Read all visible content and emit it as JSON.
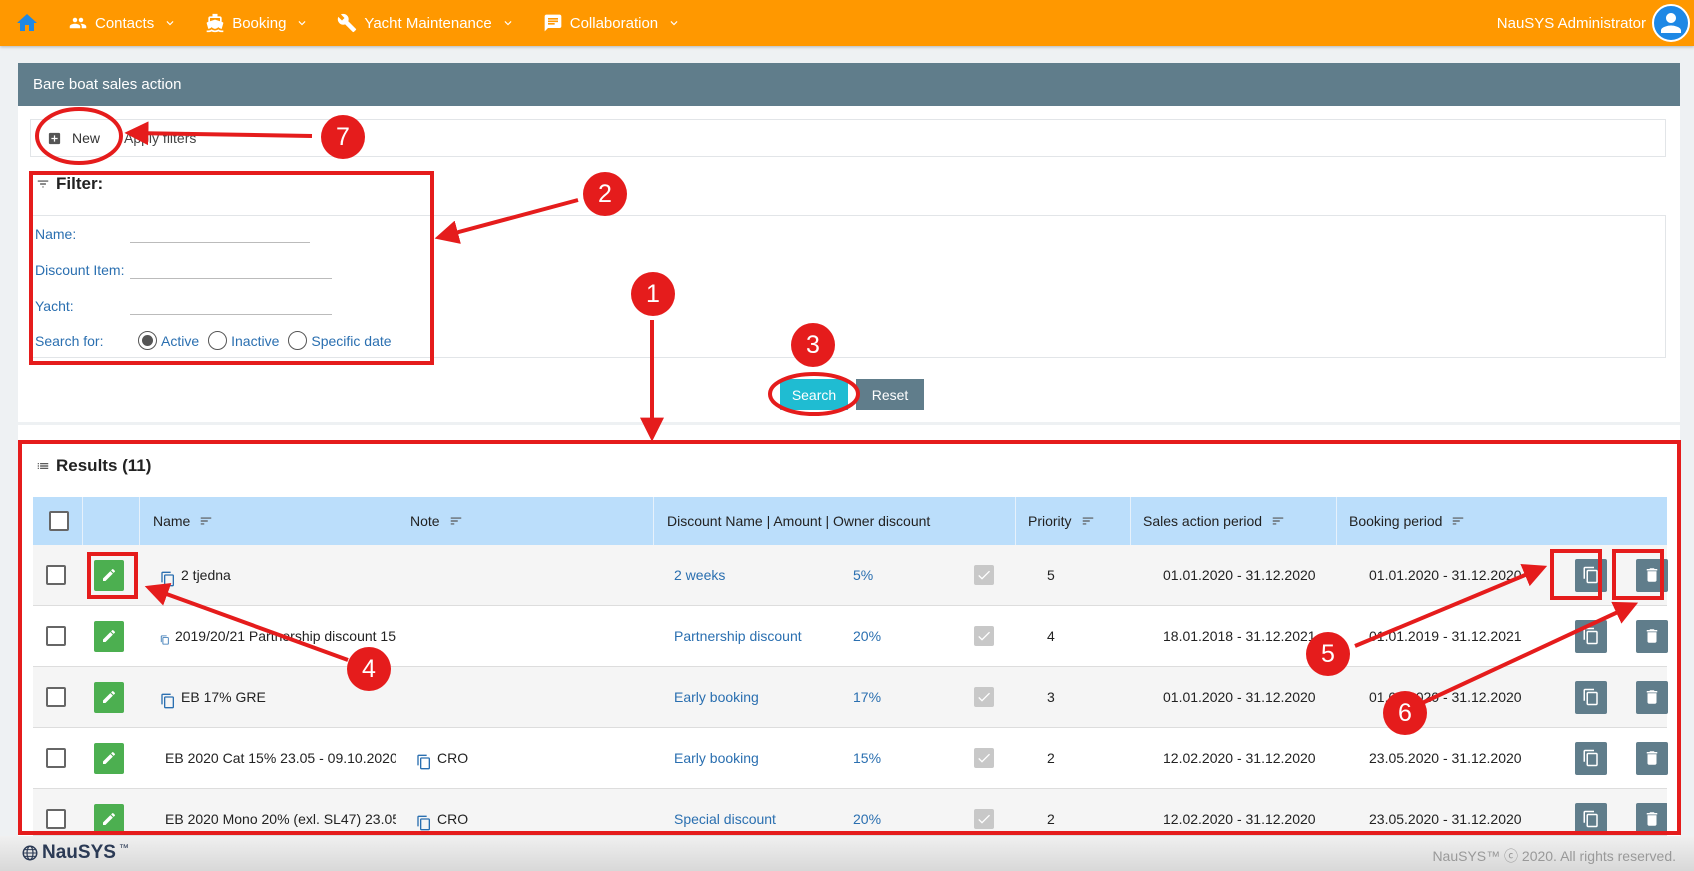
{
  "nav": {
    "items": [
      {
        "label": "Contacts"
      },
      {
        "label": "Booking"
      },
      {
        "label": "Yacht Maintenance"
      },
      {
        "label": "Collaboration"
      }
    ],
    "user": "NauSYS Administrator"
  },
  "page": {
    "title": "Bare boat sales action",
    "new_label": "New",
    "apply_filters": "Apply filters"
  },
  "filter": {
    "title": "Filter:",
    "name_label": "Name:",
    "discount_label": "Discount Item:",
    "yacht_label": "Yacht:",
    "search_for_label": "Search for:",
    "options": [
      "Active",
      "Inactive",
      "Specific date"
    ],
    "selected": "Active",
    "search_label": "Search",
    "reset_label": "Reset"
  },
  "results": {
    "title": "Results (11)",
    "headers": {
      "name": "Name",
      "note": "Note",
      "discount": "Discount Name | Amount | Owner discount",
      "priority": "Priority",
      "sales_period": "Sales action period",
      "booking_period": "Booking period"
    },
    "rows": [
      {
        "name": "2 tjedna",
        "note": "",
        "discount": "2 weeks",
        "amount": "5%",
        "priority": "5",
        "sales": "01.01.2020 - 31.12.2020",
        "booking": "01.01.2020 - 31.12.2020"
      },
      {
        "name": "2019/20/21 Partnership discount 15",
        "note": "",
        "discount": "Partnership discount",
        "amount": "20%",
        "priority": "4",
        "sales": "18.01.2018 - 31.12.2021",
        "booking": "01.01.2019 - 31.12.2021"
      },
      {
        "name": "EB 17% GRE",
        "note": "",
        "discount": "Early booking",
        "amount": "17%",
        "priority": "3",
        "sales": "01.01.2020 - 31.12.2020",
        "booking": "01.01.2020 - 31.12.2020"
      },
      {
        "name": "EB 2020 Cat 15% 23.05 - 09.10.2020",
        "note": "CRO",
        "discount": "Early booking",
        "amount": "15%",
        "priority": "2",
        "sales": "12.02.2020 - 31.12.2020",
        "booking": "23.05.2020 - 31.12.2020"
      },
      {
        "name": "EB 2020 Mono 20% (exl. SL47) 23.05",
        "note": "CRO",
        "discount": "Special discount",
        "amount": "20%",
        "priority": "2",
        "sales": "12.02.2020 - 31.12.2020",
        "booking": "23.05.2020 - 31.12.2020"
      }
    ]
  },
  "footer": {
    "brand": "NauSYS",
    "brand_tm": "™",
    "copyright": "NauSYS™ ⓒ 2020. All rights reserved."
  },
  "annotations": [
    "1",
    "2",
    "3",
    "4",
    "5",
    "6",
    "7"
  ],
  "colors": {
    "accent": "#ff9800",
    "header": "#607d8b",
    "annotation": "#e51c1c",
    "search": "#1fbcd2",
    "edit": "#4caf50"
  }
}
